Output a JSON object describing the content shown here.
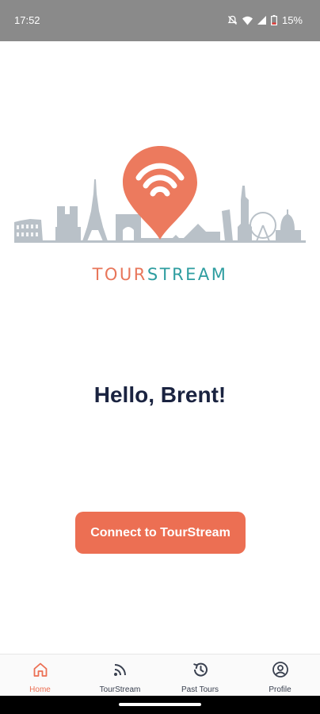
{
  "status_bar": {
    "time": "17:52",
    "battery": "15%",
    "icons": [
      "mute-icon",
      "wifi-icon",
      "signal-icon",
      "battery-low-icon"
    ]
  },
  "brand": {
    "tour": "TOUR",
    "stream": "STREAM",
    "colors": {
      "tour": "#e8765a",
      "stream": "#2e9da0",
      "skyline": "#b9c1c8"
    }
  },
  "greeting": "Hello, Brent!",
  "connect_button": {
    "label": "Connect to TourStream",
    "color": "#ec6f53"
  },
  "tabs": [
    {
      "label": "Home",
      "icon": "home-icon",
      "active": true
    },
    {
      "label": "TourStream",
      "icon": "stream-icon",
      "active": false
    },
    {
      "label": "Past Tours",
      "icon": "history-icon",
      "active": false
    },
    {
      "label": "Profile",
      "icon": "profile-icon",
      "active": false
    }
  ]
}
